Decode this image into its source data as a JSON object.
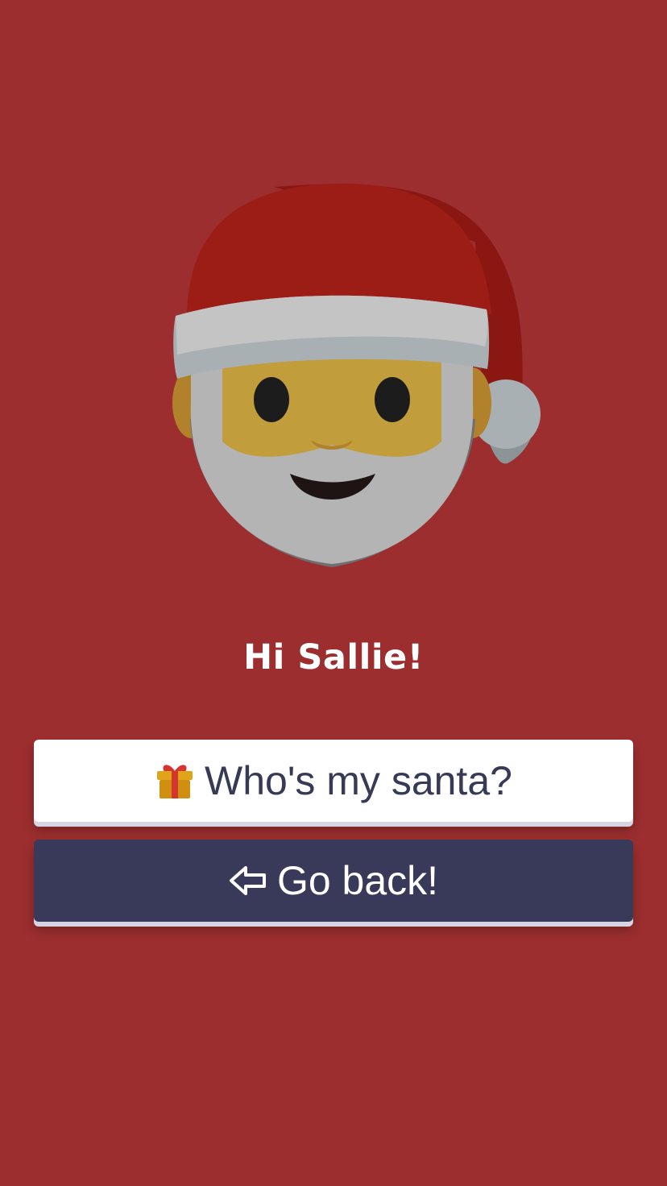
{
  "avatar": {
    "icon": "santa-face-icon",
    "colors": {
      "hat_red": "#9c1d16",
      "hat_shade": "#8a1712",
      "trim": "#c4c4c4",
      "face": "#c19d3c",
      "ear": "#b2812b",
      "beard": "#b4b4b4",
      "eye": "#1d1c1c",
      "mouth": "#1f1414",
      "nose": "#b2812b"
    }
  },
  "greeting": "Hi Sallie!",
  "buttons": {
    "primary": {
      "icon": "gift-icon",
      "label": "Who's my santa?",
      "background": "#ffffff",
      "text_color": "#363a57"
    },
    "secondary": {
      "icon": "arrow-left-icon",
      "label": "Go back!",
      "background": "#393a59",
      "text_color": "#ffffff"
    }
  },
  "page": {
    "background": "#9c2e2f"
  }
}
